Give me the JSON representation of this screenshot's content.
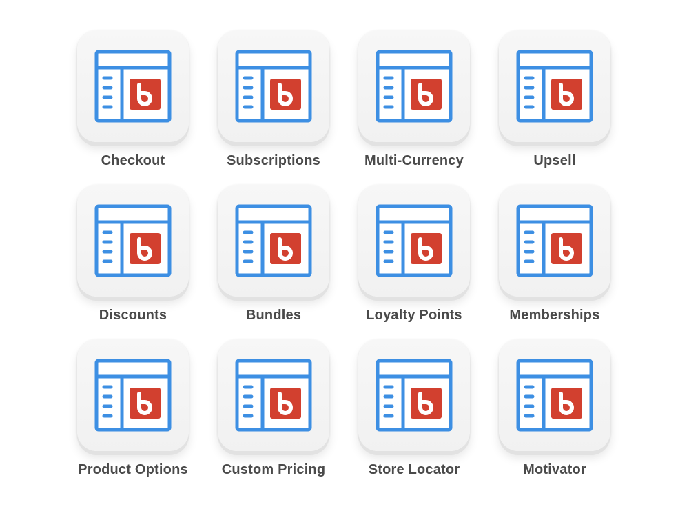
{
  "colors": {
    "window_blue": "#3d8fe3",
    "brand_red": "#d2402f",
    "label_gray": "#4a4a4a"
  },
  "apps": [
    {
      "label": "Checkout",
      "icon": "bold-app-window-icon"
    },
    {
      "label": "Subscriptions",
      "icon": "bold-app-window-icon"
    },
    {
      "label": "Multi-Currency",
      "icon": "bold-app-window-icon"
    },
    {
      "label": "Upsell",
      "icon": "bold-app-window-icon"
    },
    {
      "label": "Discounts",
      "icon": "bold-app-window-icon"
    },
    {
      "label": "Bundles",
      "icon": "bold-app-window-icon"
    },
    {
      "label": "Loyalty Points",
      "icon": "bold-app-window-icon"
    },
    {
      "label": "Memberships",
      "icon": "bold-app-window-icon"
    },
    {
      "label": "Product Options",
      "icon": "bold-app-window-icon"
    },
    {
      "label": "Custom Pricing",
      "icon": "bold-app-window-icon"
    },
    {
      "label": "Store Locator",
      "icon": "bold-app-window-icon"
    },
    {
      "label": "Motivator",
      "icon": "bold-app-window-icon"
    }
  ]
}
